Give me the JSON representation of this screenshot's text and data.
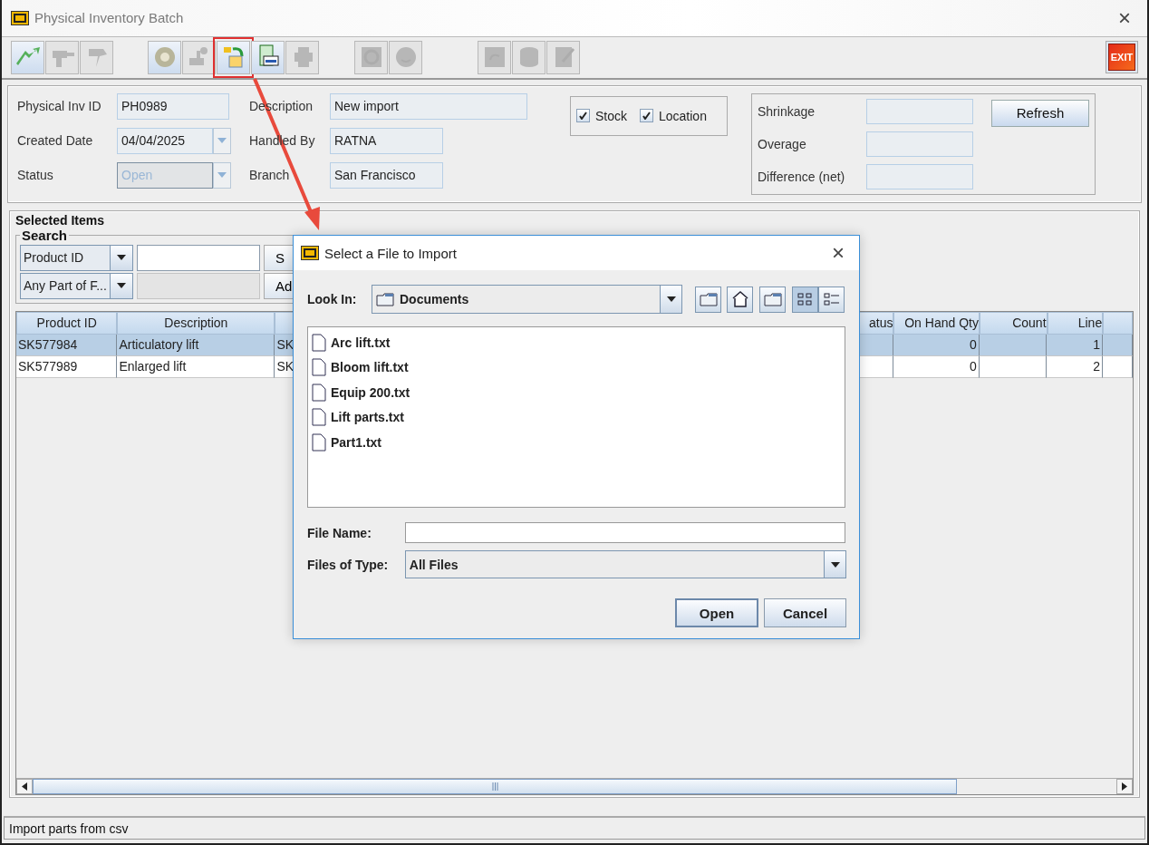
{
  "window": {
    "title": "Physical Inventory Batch",
    "close": "×"
  },
  "toolbar": {
    "groups": [
      [
        {
          "disabled": false,
          "highlighted": false
        },
        {
          "disabled": true,
          "highlighted": false
        },
        {
          "disabled": true,
          "highlighted": false
        }
      ],
      [
        {
          "disabled": false,
          "highlighted": false
        },
        {
          "disabled": true,
          "highlighted": false
        },
        {
          "disabled": false,
          "highlighted": true
        },
        {
          "disabled": false,
          "highlighted": false
        },
        {
          "disabled": true,
          "highlighted": false
        }
      ],
      [
        {
          "disabled": true,
          "highlighted": false
        },
        {
          "disabled": true,
          "highlighted": false
        }
      ],
      [
        {
          "disabled": true,
          "highlighted": false
        },
        {
          "disabled": true,
          "highlighted": false
        },
        {
          "disabled": true,
          "highlighted": false
        }
      ]
    ],
    "exit": "EXIT"
  },
  "header": {
    "left": [
      {
        "label": "Physical Inv ID",
        "value": "PH0989",
        "kind": "text"
      },
      {
        "label": "Created Date",
        "value": "04/04/2025",
        "kind": "combo"
      },
      {
        "label": "Status",
        "value": "Open",
        "kind": "combo",
        "disabled": true
      }
    ],
    "middle": [
      {
        "label": "Description",
        "value": "New import",
        "kind": "wide"
      },
      {
        "label": "Handled By",
        "value": "RATNA",
        "kind": "text"
      },
      {
        "label": "Branch",
        "value": "San Francisco",
        "kind": "text"
      }
    ],
    "checkboxes": [
      {
        "label": "Stock",
        "checked": true
      },
      {
        "label": "Location",
        "checked": true
      }
    ],
    "totals": [
      {
        "label": "Shrinkage"
      },
      {
        "label": "Overage"
      },
      {
        "label": "Difference (net)"
      }
    ],
    "refresh": "Refresh"
  },
  "selected_items": {
    "title": "Selected Items",
    "search": {
      "title": "Search",
      "rows": [
        {
          "field": "Product ID",
          "button": "S",
          "input_disabled": false
        },
        {
          "field": "Any Part of F...",
          "button": "Ad",
          "input_disabled": true
        }
      ]
    },
    "table": {
      "columns": [
        {
          "label": "Product ID"
        },
        {
          "label": "Description"
        },
        {},
        {
          "label": "atus"
        },
        {
          "label": "On Hand Qty"
        },
        {
          "label": "Count"
        },
        {
          "label": "Line"
        },
        {}
      ],
      "rows": [
        {
          "selected": true,
          "cells": [
            "SK577984",
            "Articulatory lift",
            "SK",
            null,
            "0",
            null,
            "1",
            null
          ]
        },
        {
          "selected": false,
          "cells": [
            "SK577989",
            "Enlarged lift",
            "SK",
            null,
            "0",
            null,
            "2",
            null
          ]
        }
      ]
    }
  },
  "status_bar": "Import parts from csv",
  "dialog": {
    "title": "Select a File to Import",
    "close": "×",
    "look_in_label": "Look In:",
    "look_in": "Documents",
    "view_toggles": [
      {
        "selected": true
      },
      {
        "selected": false
      }
    ],
    "files": [
      "Arc lift.txt",
      "Bloom lift.txt",
      "Equip 200.txt",
      "Lift parts.txt",
      "Part1.txt"
    ],
    "file_name_label": "File Name:",
    "file_type_label": "Files of Type:",
    "file_type": "All Files",
    "buttons": [
      {
        "label": "Open",
        "focused": true
      },
      {
        "label": "Cancel",
        "focused": false
      }
    ]
  }
}
